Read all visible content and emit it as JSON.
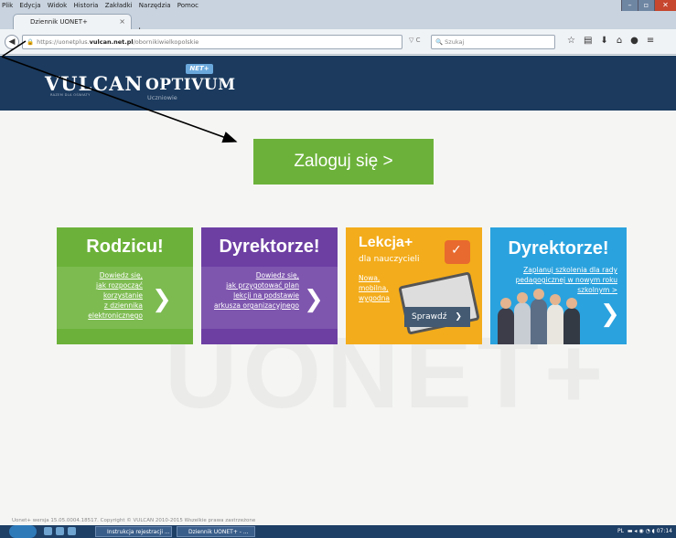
{
  "browser": {
    "menu": [
      "Plik",
      "Edycja",
      "Widok",
      "Historia",
      "Zakładki",
      "Narzędzia",
      "Pomoc"
    ],
    "tab_title": "Dziennik UONET+",
    "url_prefix": "https://uonetplus.",
    "url_domain": "vulcan.net.pl",
    "url_path": "/obornikiwielkopolskie",
    "search_placeholder": "Szukaj",
    "win_min": "–",
    "win_max": "▫",
    "win_close": "✕"
  },
  "header": {
    "logo": "VULCAN",
    "logo_sub": "RAZEM DLA OŚWIATY",
    "product": "OPTIVUM",
    "product_badge": "NET+",
    "product_sub": "Uczniowie"
  },
  "login_label": "Zaloguj się >",
  "watermark": "UONET+",
  "tiles": [
    {
      "title": "Rodzicu!",
      "text": [
        "Dowiedz się,",
        "jak rozpocząć",
        "korzystanie",
        "z dziennika",
        "elektronicznego"
      ],
      "color": "#6cb23a"
    },
    {
      "title": "Dyrektorze!",
      "text": [
        "Dowiedz się,",
        "jak przygotować plan",
        "lekcji na podstawie",
        "arkusza organizacyjnego"
      ],
      "color": "#6d3fa3"
    },
    {
      "title": "Lekcja+",
      "subtitle": "dla nauczycieli",
      "text": [
        "Nowa,",
        "mobilna,",
        "wygodna"
      ],
      "button": "Sprawdź",
      "color": "#f3ac1b"
    },
    {
      "title": "Dyrektorze!",
      "text": [
        "Zaplanuj szkolenia  dla rady",
        "pedagogicznej w nowym roku",
        "szkolnym >"
      ],
      "color": "#2aa2de"
    }
  ],
  "footer": "Uonet+ wersja 15.05.0004.18517. Copyright © VULCAN 2010-2015 Wszelkie prawa zastrzeżone",
  "taskbar": {
    "task1": "Instrukcja rejestracji ...",
    "task2": "Dziennik UONET+ - ...",
    "lang": "PL",
    "time": "07:14"
  }
}
